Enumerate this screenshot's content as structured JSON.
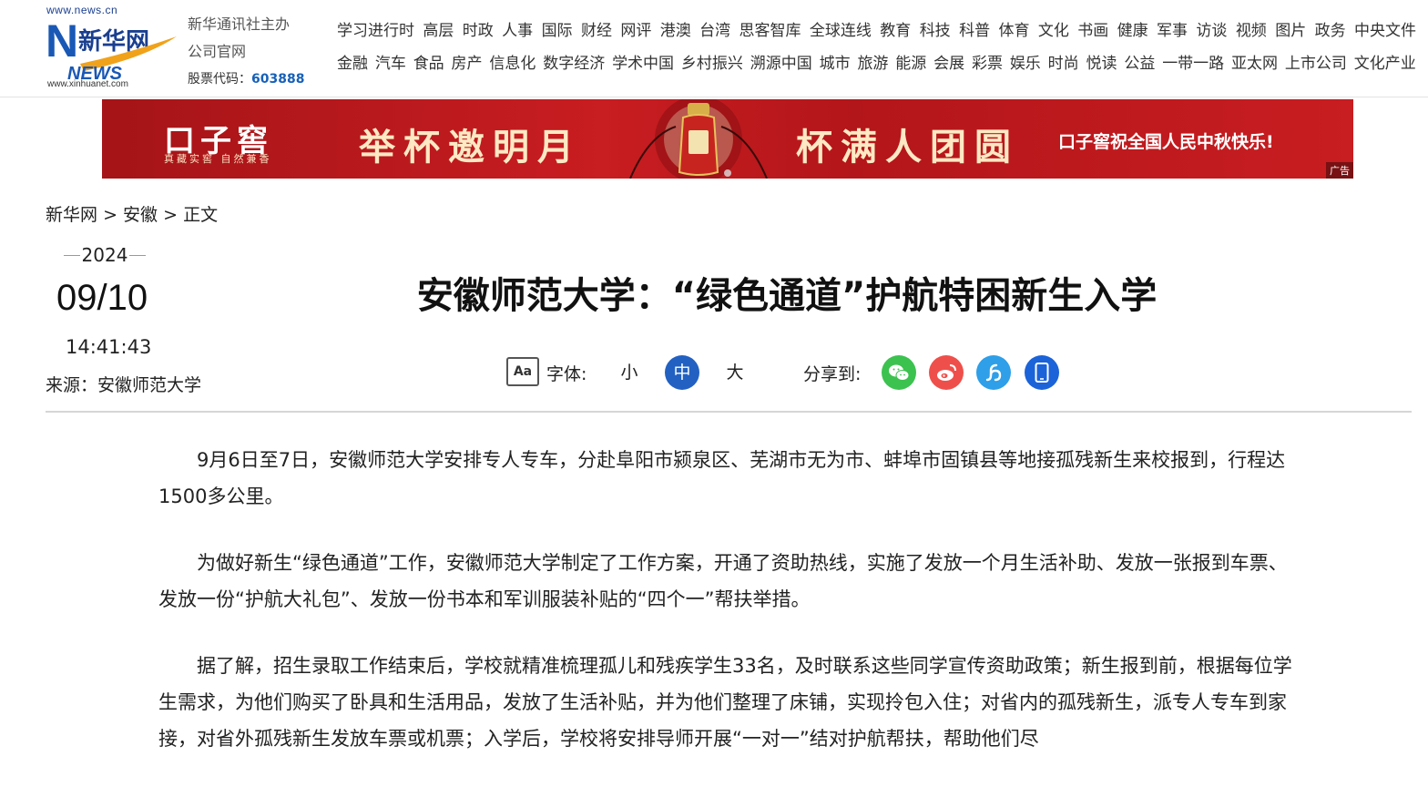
{
  "header": {
    "logo_url_top": "www.news.cn",
    "logo_text": "新华网",
    "logo_news": "NEWS",
    "logo_url_bottom": "www.xinhuanet.com",
    "org_line1": "新华通讯社主办",
    "org_line2": "公司官网",
    "stock_label": "股票代码：",
    "stock_code": "603888"
  },
  "nav": {
    "row1": [
      "学习进行时",
      "高层",
      "时政",
      "人事",
      "国际",
      "财经",
      "网评",
      "港澳",
      "台湾",
      "思客智库",
      "全球连线",
      "教育",
      "科技",
      "科普",
      "体育",
      "文化",
      "书画",
      "健康",
      "军事",
      "访谈",
      "视频",
      "图片",
      "政务",
      "中央文件"
    ],
    "row2": [
      "金融",
      "汽车",
      "食品",
      "房产",
      "信息化",
      "数字经济",
      "学术中国",
      "乡村振兴",
      "溯源中国",
      "城市",
      "旅游",
      "能源",
      "会展",
      "彩票",
      "娱乐",
      "时尚",
      "悦读",
      "公益",
      "一带一路",
      "亚太网",
      "上市公司",
      "文化产业"
    ]
  },
  "banner": {
    "brand": "口子窖",
    "brand_sub": "真藏实窖 自然兼香",
    "slogan_1": "举杯邀明月",
    "slogan_2": "杯满人团圆",
    "greeting": "口子窖祝全国人民中秋快乐!",
    "ad_tag": "广告"
  },
  "breadcrumb": {
    "items": [
      "新华网",
      "安徽",
      "正文"
    ],
    "separator": ">"
  },
  "meta": {
    "year": "2024",
    "month_day": "09/10",
    "time": "14:41:43",
    "source": "来源：安徽师范大学"
  },
  "article": {
    "title": "安徽师范大学：“绿色通道”护航特困新生入学",
    "paragraphs": [
      "9月6日至7日，安徽师范大学安排专人专车，分赴阜阳市颍泉区、芜湖市无为市、蚌埠市固镇县等地接孤残新生来校报到，行程达1500多公里。",
      "为做好新生“绿色通道”工作，安徽师范大学制定了工作方案，开通了资助热线，实施了发放一个月生活补助、发放一张报到车票、发放一份“护航大礼包”、发放一份书本和军训服装补贴的“四个一”帮扶举措。",
      "据了解，招生录取工作结束后，学校就精准梳理孤儿和残疾学生33名，及时联系这些同学宣传资助政策；新生报到前，根据每位学生需求，为他们购买了卧具和生活用品，发放了生活补贴，并为他们整理了床铺，实现拎包入住；对省内的孤残新生，派专人专车到家接，对省外孤残新生发放车票或机票；入学后，学校将安排导师开展“一对一”结对护航帮扶，帮助他们尽"
    ]
  },
  "toolbar": {
    "font_icon_text": "Aa",
    "font_label": "字体:",
    "font_small": "小",
    "font_medium": "中",
    "font_large": "大",
    "font_selected": "中",
    "share_label": "分享到:",
    "share_targets": [
      "wechat-icon",
      "weibo-icon",
      "link-icon",
      "mobile-icon"
    ]
  },
  "colors": {
    "accent_blue": "#2261c2",
    "stock_code": "#1760b8",
    "banner_red": "#c81d21",
    "wechat": "#3cc24f",
    "weibo": "#ef4f4a",
    "link": "#2e9fe8",
    "mobile": "#1b63d8"
  }
}
